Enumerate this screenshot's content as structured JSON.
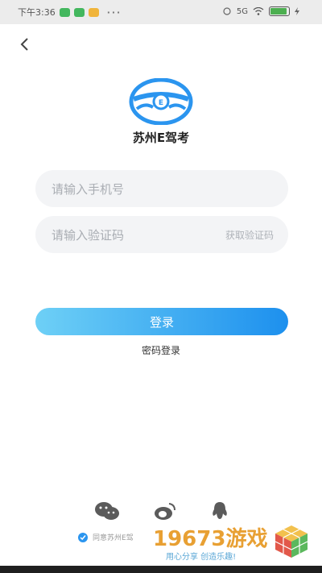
{
  "status_bar": {
    "time": "下午3:36",
    "dots": "···",
    "network": "5G"
  },
  "app": {
    "name": "苏州E驾考"
  },
  "phone_field": {
    "placeholder": "请输入手机号",
    "value": ""
  },
  "code_field": {
    "placeholder": "请输入验证码",
    "value": "",
    "get_code_label": "获取验证码"
  },
  "login_button": {
    "label": "登录"
  },
  "password_login": {
    "label": "密码登录"
  },
  "agreement": {
    "text": "同意苏州E驾"
  },
  "watermark": {
    "number": "19673游戏",
    "slogan": "用心分享 创造乐趣!"
  },
  "colors": {
    "accent": "#2b95ef",
    "gradient_start": "#6ed0f6",
    "gradient_end": "#1d90ee",
    "field_bg": "#f3f4f6"
  }
}
